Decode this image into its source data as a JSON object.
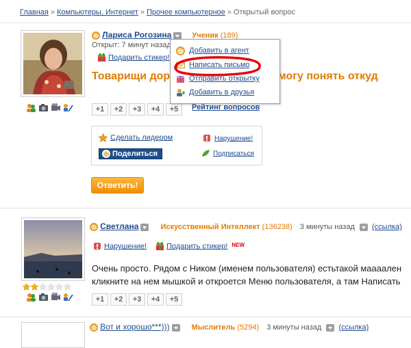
{
  "breadcrumb": {
    "items": [
      "Главная",
      "Компьютеры, Интернет",
      "Прочее компьютерное",
      "Открытый вопрос"
    ],
    "separator": "»"
  },
  "question": {
    "author": "Лариса Рогозина",
    "rank": "Ученик",
    "points": "(189)",
    "opened": "Открыт: 7 минут назад",
    "sticker": "Подарить стикер!",
    "title": "Товарищи доро",
    "title_rest": "ичку.Не могу понять откуд",
    "votes": [
      "+1",
      "+2",
      "+3",
      "+4",
      "+5"
    ],
    "rating_link": "Рейтинг вопросов",
    "actions": {
      "make_leader": "Сделать лидером",
      "violation": "Нарушение!",
      "share": "Поделиться",
      "subscribe": "Подписаться"
    },
    "answer_button": "Ответить!"
  },
  "user_menu": {
    "items": [
      "Добавить в агент",
      "Написать письмо",
      "Отправить открытку",
      "Добавить в друзья"
    ],
    "highlight_color": "#e8000b"
  },
  "answers": [
    {
      "author": "Светлана",
      "rank": "Искусственный Интеллект",
      "points": "(136238)",
      "time": "3 минуты назад",
      "link": "(ссылка)",
      "violation": "Нарушение!",
      "sticker": "Подарить стикер!",
      "new_badge": "NEW",
      "text_line1": "Очень просто. Рядом с Ником (именем пользователя) естьтакой маааален",
      "text_line2": "кликните на нем мышкой и откроется Меню пользователя, а там Написать",
      "votes": [
        "+1",
        "+2",
        "+3",
        "+4",
        "+5"
      ],
      "stars_filled": 2,
      "stars_total": 6
    },
    {
      "author": "Вот и хорошо***)))",
      "rank": "Мыслитель",
      "points": "(5294)",
      "time": "3 минуты назад",
      "link": "(ссылка)"
    }
  ],
  "colors": {
    "link": "#1f4b8f",
    "accent_orange": "#e07c00",
    "share_blue": "#1d4f8a"
  }
}
